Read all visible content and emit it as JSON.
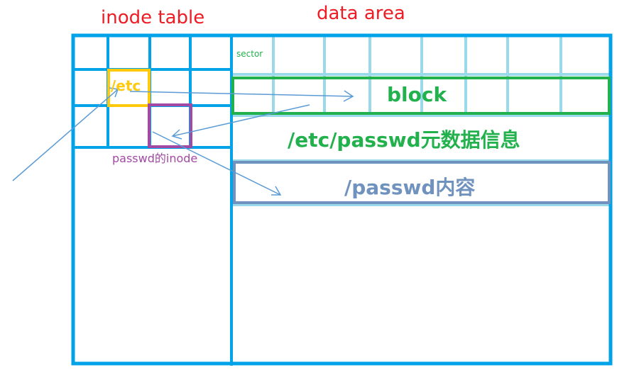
{
  "titles": {
    "inode_table": "inode table",
    "data_area": "data area"
  },
  "labels": {
    "etc": "/etc",
    "passwd_inode": "passwd的inode",
    "sector": "sector",
    "block": "block",
    "metadata": "/etc/passwd元数据信息",
    "content": "/passwd内容"
  },
  "colors": {
    "grid_blue": "#00a2e8",
    "sector_lines": "#99d9ea",
    "title_red": "#ee1c24",
    "etc_yellow": "#ffc90e",
    "inode_purple": "#a349a4",
    "block_green": "#22b14c",
    "content_slate": "#7092be",
    "arrow_blue": "#5b9bd5"
  }
}
